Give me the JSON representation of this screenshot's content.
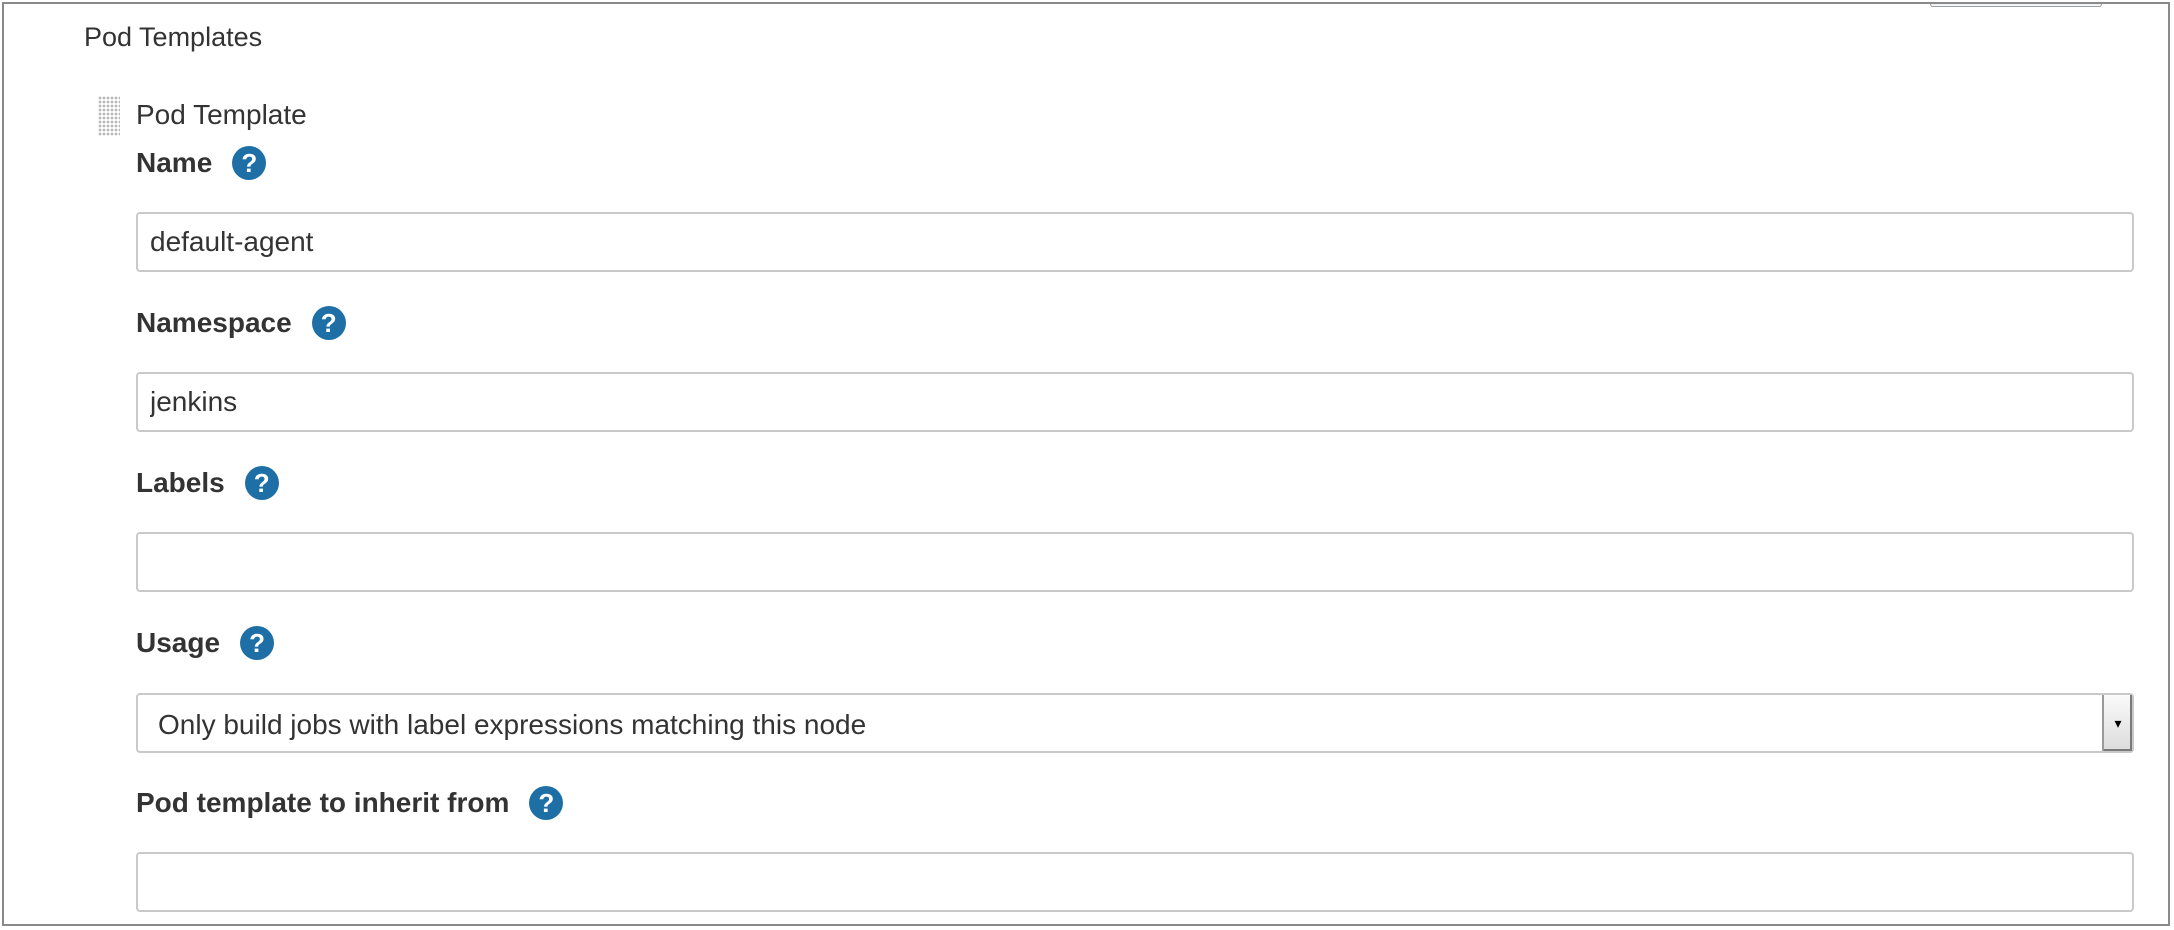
{
  "section": {
    "title": "Pod Templates"
  },
  "template": {
    "title": "Pod Template"
  },
  "fields": {
    "name": {
      "label": "Name",
      "value": "default-agent"
    },
    "namespace": {
      "label": "Namespace",
      "value": "jenkins"
    },
    "labels": {
      "label": "Labels",
      "value": ""
    },
    "usage": {
      "label": "Usage",
      "value": "Only build jobs with label expressions matching this node"
    },
    "inherit": {
      "label": "Pod template to inherit from",
      "value": ""
    }
  },
  "icons": {
    "help": "?",
    "dropdown": "▾"
  },
  "colors": {
    "help_icon": "#1d6fa5",
    "input_border": "#c9c9c9"
  }
}
